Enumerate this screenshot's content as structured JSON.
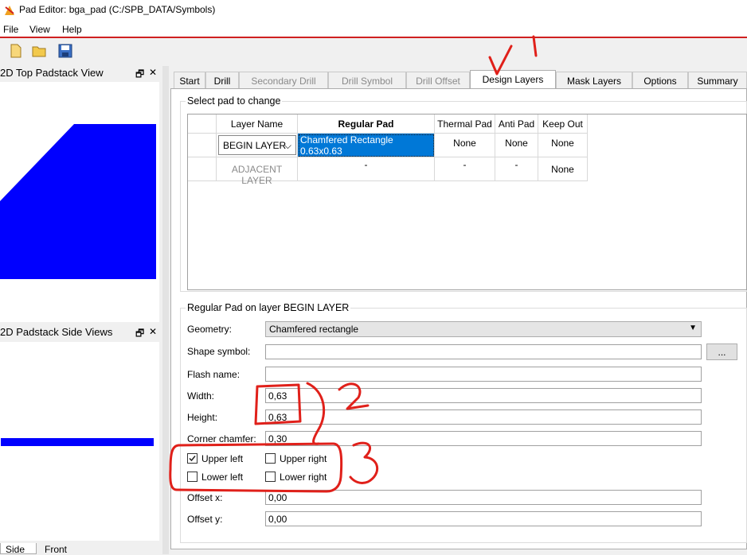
{
  "window": {
    "title": "Pad Editor: bga_pad  (C:/SPB_DATA/Symbols)"
  },
  "menu": [
    "File",
    "View",
    "Help"
  ],
  "toolbar": {
    "icons": [
      "new-file-icon",
      "open-folder-icon",
      "save-icon"
    ]
  },
  "top_view": {
    "title": "2D Top Padstack View",
    "controls": [
      "🗗",
      "✕"
    ]
  },
  "side_view": {
    "title": "2D Padstack Side Views",
    "controls": [
      "🗗",
      "✕"
    ],
    "bottom_tabs": [
      "Side",
      "Front"
    ]
  },
  "tabs": [
    "Start",
    "Drill",
    "Secondary Drill",
    "Drill Symbol",
    "Drill Offset",
    "Design Layers",
    "Mask Layers",
    "Options",
    "Summary"
  ],
  "select_group": {
    "title": "Select pad to change",
    "headers": [
      "Layer Name",
      "Regular Pad",
      "Thermal Pad",
      "Anti Pad",
      "Keep Out"
    ],
    "rows": [
      {
        "layer": "BEGIN LAYER",
        "regular": "Chamfered Rectangle 0.63x0.63",
        "thermal": "None",
        "anti": "None",
        "keepout": "None"
      },
      {
        "layer": "ADJACENT LAYER",
        "regular": "-",
        "thermal": "-",
        "anti": "-",
        "keepout": "None"
      }
    ]
  },
  "regular_group": {
    "title": "Regular Pad on layer BEGIN LAYER",
    "geometry_label": "Geometry:",
    "geometry_value": "Chamfered rectangle",
    "shape_symbol_label": "Shape symbol:",
    "shape_symbol_value": "",
    "browse_label": "...",
    "flash_name_label": "Flash name:",
    "flash_name_value": "",
    "width_label": "Width:",
    "width_value": "0,63",
    "height_label": "Height:",
    "height_value": "0,63",
    "corner_label": "Corner chamfer:",
    "corner_value": "0,30",
    "upper_left": "Upper left",
    "upper_right": "Upper right",
    "lower_left": "Lower left",
    "lower_right": "Lower right",
    "offset_x_label": "Offset x:",
    "offset_x_value": "0,00",
    "offset_y_label": "Offset y:",
    "offset_y_value": "0,00"
  },
  "checkbox_states": {
    "upper_left": true,
    "upper_right": false,
    "lower_left": false,
    "lower_right": false
  },
  "annotations": [
    "1",
    "2",
    "3"
  ],
  "colors": {
    "pad": "#0000ff",
    "selection": "#0078d7",
    "annotation": "#e0201a",
    "menu_line": "#d02020"
  }
}
